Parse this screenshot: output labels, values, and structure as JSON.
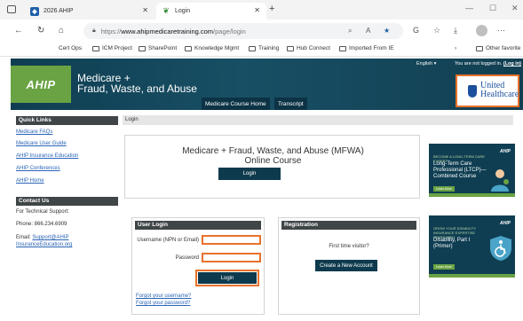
{
  "browser": {
    "tabs": [
      {
        "title": "2026 AHIP",
        "active": false
      },
      {
        "title": "Login",
        "active": true
      }
    ],
    "url_protocol": "https://",
    "url_host": "www.ahipmedicaretraining.com",
    "url_path": "/page/login",
    "bookmarks": [
      "Cert Ops",
      "ICM Project",
      "SharePoint",
      "Knowledge Mgmt",
      "Training",
      "Hub Connect",
      "Imported From IE"
    ],
    "other_favorites": "Other favorite"
  },
  "header": {
    "language": "English ▾",
    "not_logged_in": "You are not logged in.",
    "login_link": "(Log in)",
    "logo_text": "AHIP",
    "title_line1": "Medicare +",
    "title_line2": "Fraud, Waste, and Abuse",
    "nav": [
      "Medicare Course Home",
      "Transcript"
    ],
    "partner_line1": "United",
    "partner_line2": "Healthcare"
  },
  "sidebar": {
    "quick_links_title": "Quick Links",
    "quick_links": [
      "Medicare FAQs",
      "Medicare User Guide",
      "AHIP Insurance Education",
      "AHIP Conferences",
      "AHIP Home"
    ],
    "contact_title": "Contact Us",
    "support_label": "For Technical Support:",
    "phone": "Phone: 866.234.6909",
    "email_label": "Email:",
    "email_line1": "Support@AHIP",
    "email_line2": "InsuranceEducation.org"
  },
  "main": {
    "breadcrumb": "Login",
    "course_line1": "Medicare + Fraud, Waste, and Abuse (MFWA)",
    "course_line2": "Online Course",
    "course_login_button": "Login",
    "user_login": {
      "title": "User Login",
      "username_label": "Username (NPN or Email)",
      "username_value": "",
      "password_label": "Password",
      "password_value": "",
      "login_button": "Login",
      "forgot_username": "Forgot your username?",
      "forgot_password": "Forgot your password?"
    },
    "registration": {
      "title": "Registration",
      "prompt": "First time visitor?",
      "create_button": "Create a New Account"
    }
  },
  "ads": [
    {
      "brand": "AHIP",
      "kicker": "BECOME A LONG-TERM CARE EXPERT",
      "headline": "Long-Term Care Professional (LTCP)— Combined Course",
      "cta": "Learn More"
    },
    {
      "brand": "AHIP",
      "kicker": "GROW YOUR DISABILITY INSURANCE EXPERTISE START WITH",
      "headline": "Disability, Part I (Primer)",
      "cta": "Learn More"
    }
  ],
  "colors": {
    "header_bg": "#123f52",
    "ahip_green": "#6aa343",
    "highlight": "#e8722a",
    "button_dark": "#0e3a4d",
    "link": "#2a64b5"
  }
}
